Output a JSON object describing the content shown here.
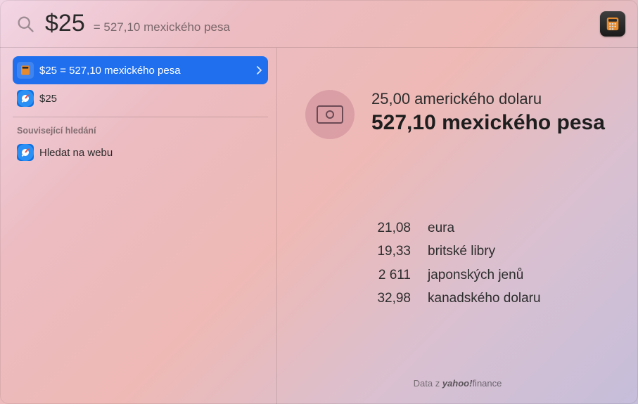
{
  "search": {
    "query_main": "$25",
    "query_sub": "= 527,10 mexického pesa"
  },
  "sidebar": {
    "results": [
      {
        "icon": "calculator",
        "label": "$25 = 527,10 mexického pesa",
        "selected": true,
        "has_chevron": true
      },
      {
        "icon": "safari",
        "label": "$25",
        "selected": false,
        "has_chevron": false
      }
    ],
    "section_header": "Související hledání",
    "related": [
      {
        "icon": "safari",
        "label": "Hledat na webu"
      }
    ]
  },
  "detail": {
    "from_line": "25,00 amerického dolaru",
    "to_line": "527,10 mexického pesa",
    "rates": [
      {
        "value": "21,08",
        "label": "eura"
      },
      {
        "value": "19,33",
        "label": "britské libry"
      },
      {
        "value": "2 611",
        "label": "japonských jenů"
      },
      {
        "value": "32,98",
        "label": "kanadského dolaru"
      }
    ],
    "source_prefix": "Data z ",
    "source_brand_strong": "yahoo!",
    "source_brand_light": "finance"
  }
}
